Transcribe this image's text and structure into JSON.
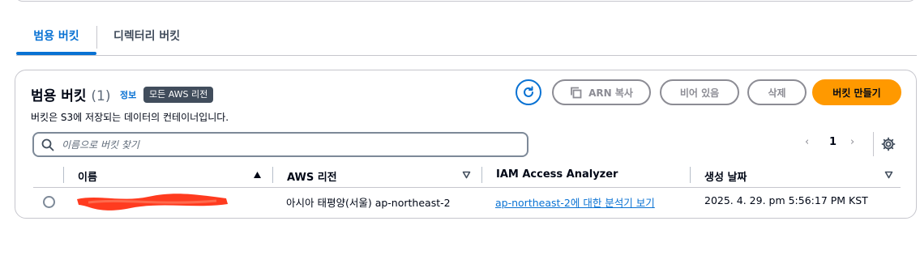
{
  "tabs": [
    {
      "label": "범용 버킷",
      "active": true
    },
    {
      "label": "디렉터리 버킷",
      "active": false
    }
  ],
  "panel": {
    "title": "범용 버킷",
    "count": "(1)",
    "info": "정보",
    "region_badge": "모든 AWS 리전",
    "description": "버킷은 S3에 저장되는 데이터의 컨테이너입니다."
  },
  "toolbar": {
    "refresh_icon": "refresh-icon",
    "copy_arn_label": "ARN 복사",
    "empty_label": "비어 있음",
    "delete_label": "삭제",
    "create_label": "버킷 만들기"
  },
  "search": {
    "placeholder": "이름으로 버킷 찾기",
    "value": ""
  },
  "pagination": {
    "prev": "‹",
    "current": "1",
    "next": "›"
  },
  "table": {
    "columns": [
      "이름",
      "AWS 리전",
      "IAM Access Analyzer",
      "생성 날짜"
    ],
    "rows": [
      {
        "name": "",
        "region": "아시아 태평양(서울) ap-northeast-2",
        "iam": "ap-northeast-2에 대한 분석기 보기",
        "created": "2025. 4. 29. pm 5:56:17 PM KST"
      }
    ]
  },
  "colors": {
    "accent": "#0972d3",
    "primary_button": "#ff9900",
    "disabled": "#8c8c94",
    "badge": "#414d5c",
    "redaction": "#ff3b1f"
  }
}
